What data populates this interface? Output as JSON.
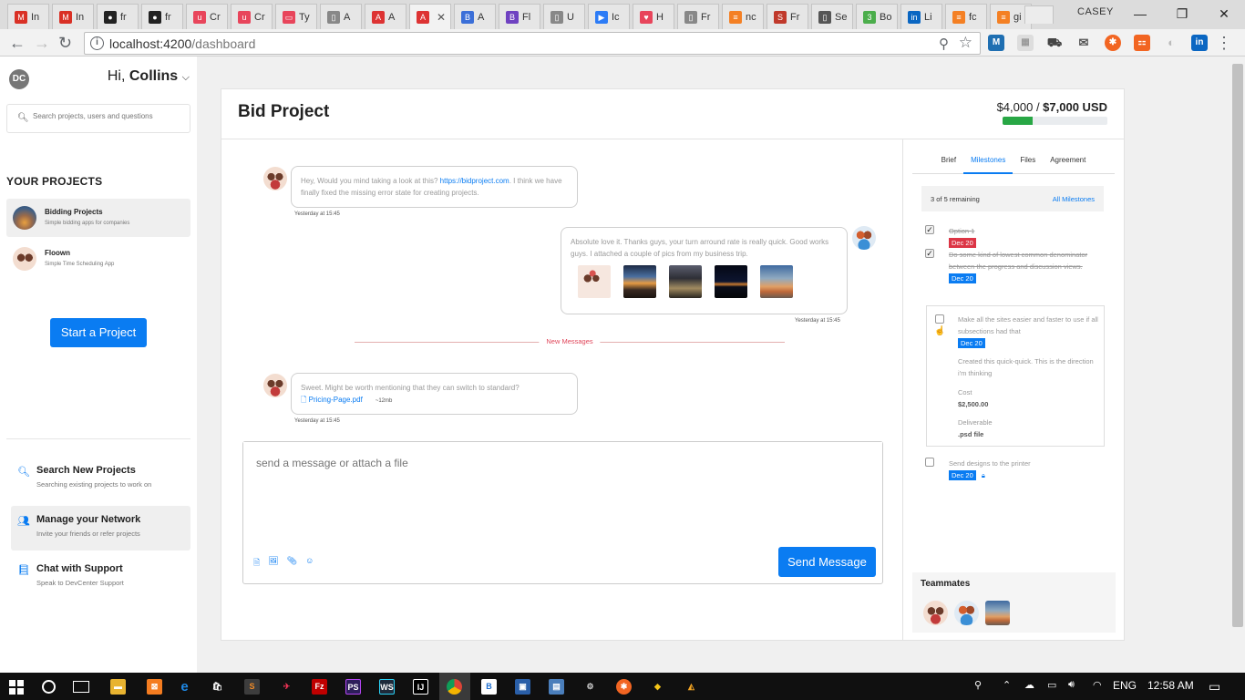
{
  "browser": {
    "tabs": [
      {
        "label": "In",
        "color": "#d93025",
        "glyph": "M"
      },
      {
        "label": "In",
        "color": "#d93025",
        "glyph": "M"
      },
      {
        "label": "fr",
        "color": "#222222",
        "glyph": "●"
      },
      {
        "label": "fr",
        "color": "#222222",
        "glyph": "●"
      },
      {
        "label": "Cr",
        "color": "#e8455b",
        "glyph": "u"
      },
      {
        "label": "Cr",
        "color": "#e8455b",
        "glyph": "u"
      },
      {
        "label": "Ty",
        "color": "#e8455b",
        "glyph": "▭"
      },
      {
        "label": "A",
        "color": "#888888",
        "glyph": "▯"
      },
      {
        "label": "A",
        "color": "#dd3333",
        "glyph": "A"
      },
      {
        "label": "",
        "color": "#dd3333",
        "glyph": "A"
      },
      {
        "label": "A",
        "color": "#3b6fd8",
        "glyph": "B"
      },
      {
        "label": "Fl",
        "color": "#6f42c1",
        "glyph": "B"
      },
      {
        "label": "U",
        "color": "#888888",
        "glyph": "▯"
      },
      {
        "label": "Ic",
        "color": "#2d7cf6",
        "glyph": "▶"
      },
      {
        "label": "H",
        "color": "#e8455b",
        "glyph": "♥"
      },
      {
        "label": "Fr",
        "color": "#888888",
        "glyph": "▯"
      },
      {
        "label": "nc",
        "color": "#f48024",
        "glyph": "≡"
      },
      {
        "label": "Fr",
        "color": "#c0392b",
        "glyph": "S"
      },
      {
        "label": "Se",
        "color": "#555555",
        "glyph": "▯"
      },
      {
        "label": "Bo",
        "color": "#4cae4c",
        "glyph": "3"
      },
      {
        "label": "Li",
        "color": "#0a66c2",
        "glyph": "in"
      },
      {
        "label": "fc",
        "color": "#f48024",
        "glyph": "≡"
      },
      {
        "label": "gi",
        "color": "#f48024",
        "glyph": "≡"
      }
    ],
    "profile": "CASEY",
    "url_host": "localhost:4200",
    "url_path": "/dashboard"
  },
  "sidebar": {
    "logo": "DC",
    "greeting_prefix": "Hi,",
    "user_name": "Collins",
    "search_placeholder": "Search projects, users and questions",
    "projects_title": "YOUR PROJECTS",
    "projects": [
      {
        "name": "Bidding Projects",
        "desc": "Simple bidding apps for companies"
      },
      {
        "name": "Floown",
        "desc": "Simple Time Scheduling App"
      }
    ],
    "start_button": "Start a Project",
    "actions": [
      {
        "title": "Search New Projects",
        "sub": "Searching existing projects to work on"
      },
      {
        "title": "Manage your Network",
        "sub": "Invite your friends or refer projects"
      },
      {
        "title": "Chat with Support",
        "sub": "Speak to DevCenter Support"
      }
    ]
  },
  "project": {
    "title": "Bid Project",
    "budget_spent": "$4,000",
    "budget_sep": " / ",
    "budget_total": "$7,000 USD",
    "budget_progress": 0.29
  },
  "messages": [
    {
      "text_before": "Hey, Would you mind taking a look at this? ",
      "link": "https://bidproject.com",
      "text_after": ". I think we have finally fixed the missing error state for creating projects.",
      "time": "Yesterday at 15:45"
    },
    {
      "text": "Absolute love it. Thanks guys, your turn arround rate is really quick. Good works guys. I attached a couple of pics from my business trip.",
      "time": "Yesterday at 15:45"
    },
    {
      "text": "Sweet. Might be worth mentioning that they can switch to standard?",
      "file": "Pricing-Page.pdf",
      "size": "~12mb",
      "time": "Yesterday at 15:45"
    }
  ],
  "new_messages_label": "New Messages",
  "composer": {
    "placeholder": "send a message or attach a file",
    "send": "Send Message"
  },
  "right_panel": {
    "tabs": [
      "Brief",
      "Milestones",
      "Files",
      "Agreement"
    ],
    "remaining": "3 of 5 remaining",
    "all_milestones": "All Milestones",
    "milestones": [
      {
        "text": "Option 1",
        "date": "Dec 20"
      },
      {
        "text": "Do some kind of lowest common denominator between the progress and discussion views.",
        "date": "Dec 20"
      },
      {
        "text": "Make all the sites easier and faster to use if all subsections had that",
        "date": "Dec 20",
        "note": "Created this quick-quick. This is the direction i'm thinking",
        "cost_label": "Cost",
        "cost": "$2,500.00",
        "deliverable_label": "Deliverable",
        "deliverable": ".psd file"
      },
      {
        "text": "Send designs to the printer",
        "date": "Dec 20"
      }
    ],
    "teammates_title": "Teammates"
  },
  "taskbar": {
    "lang": "ENG",
    "time": "12:58 AM"
  },
  "colors": {
    "primary": "#0a7cf2",
    "success": "#28a745",
    "danger": "#dc3545"
  }
}
